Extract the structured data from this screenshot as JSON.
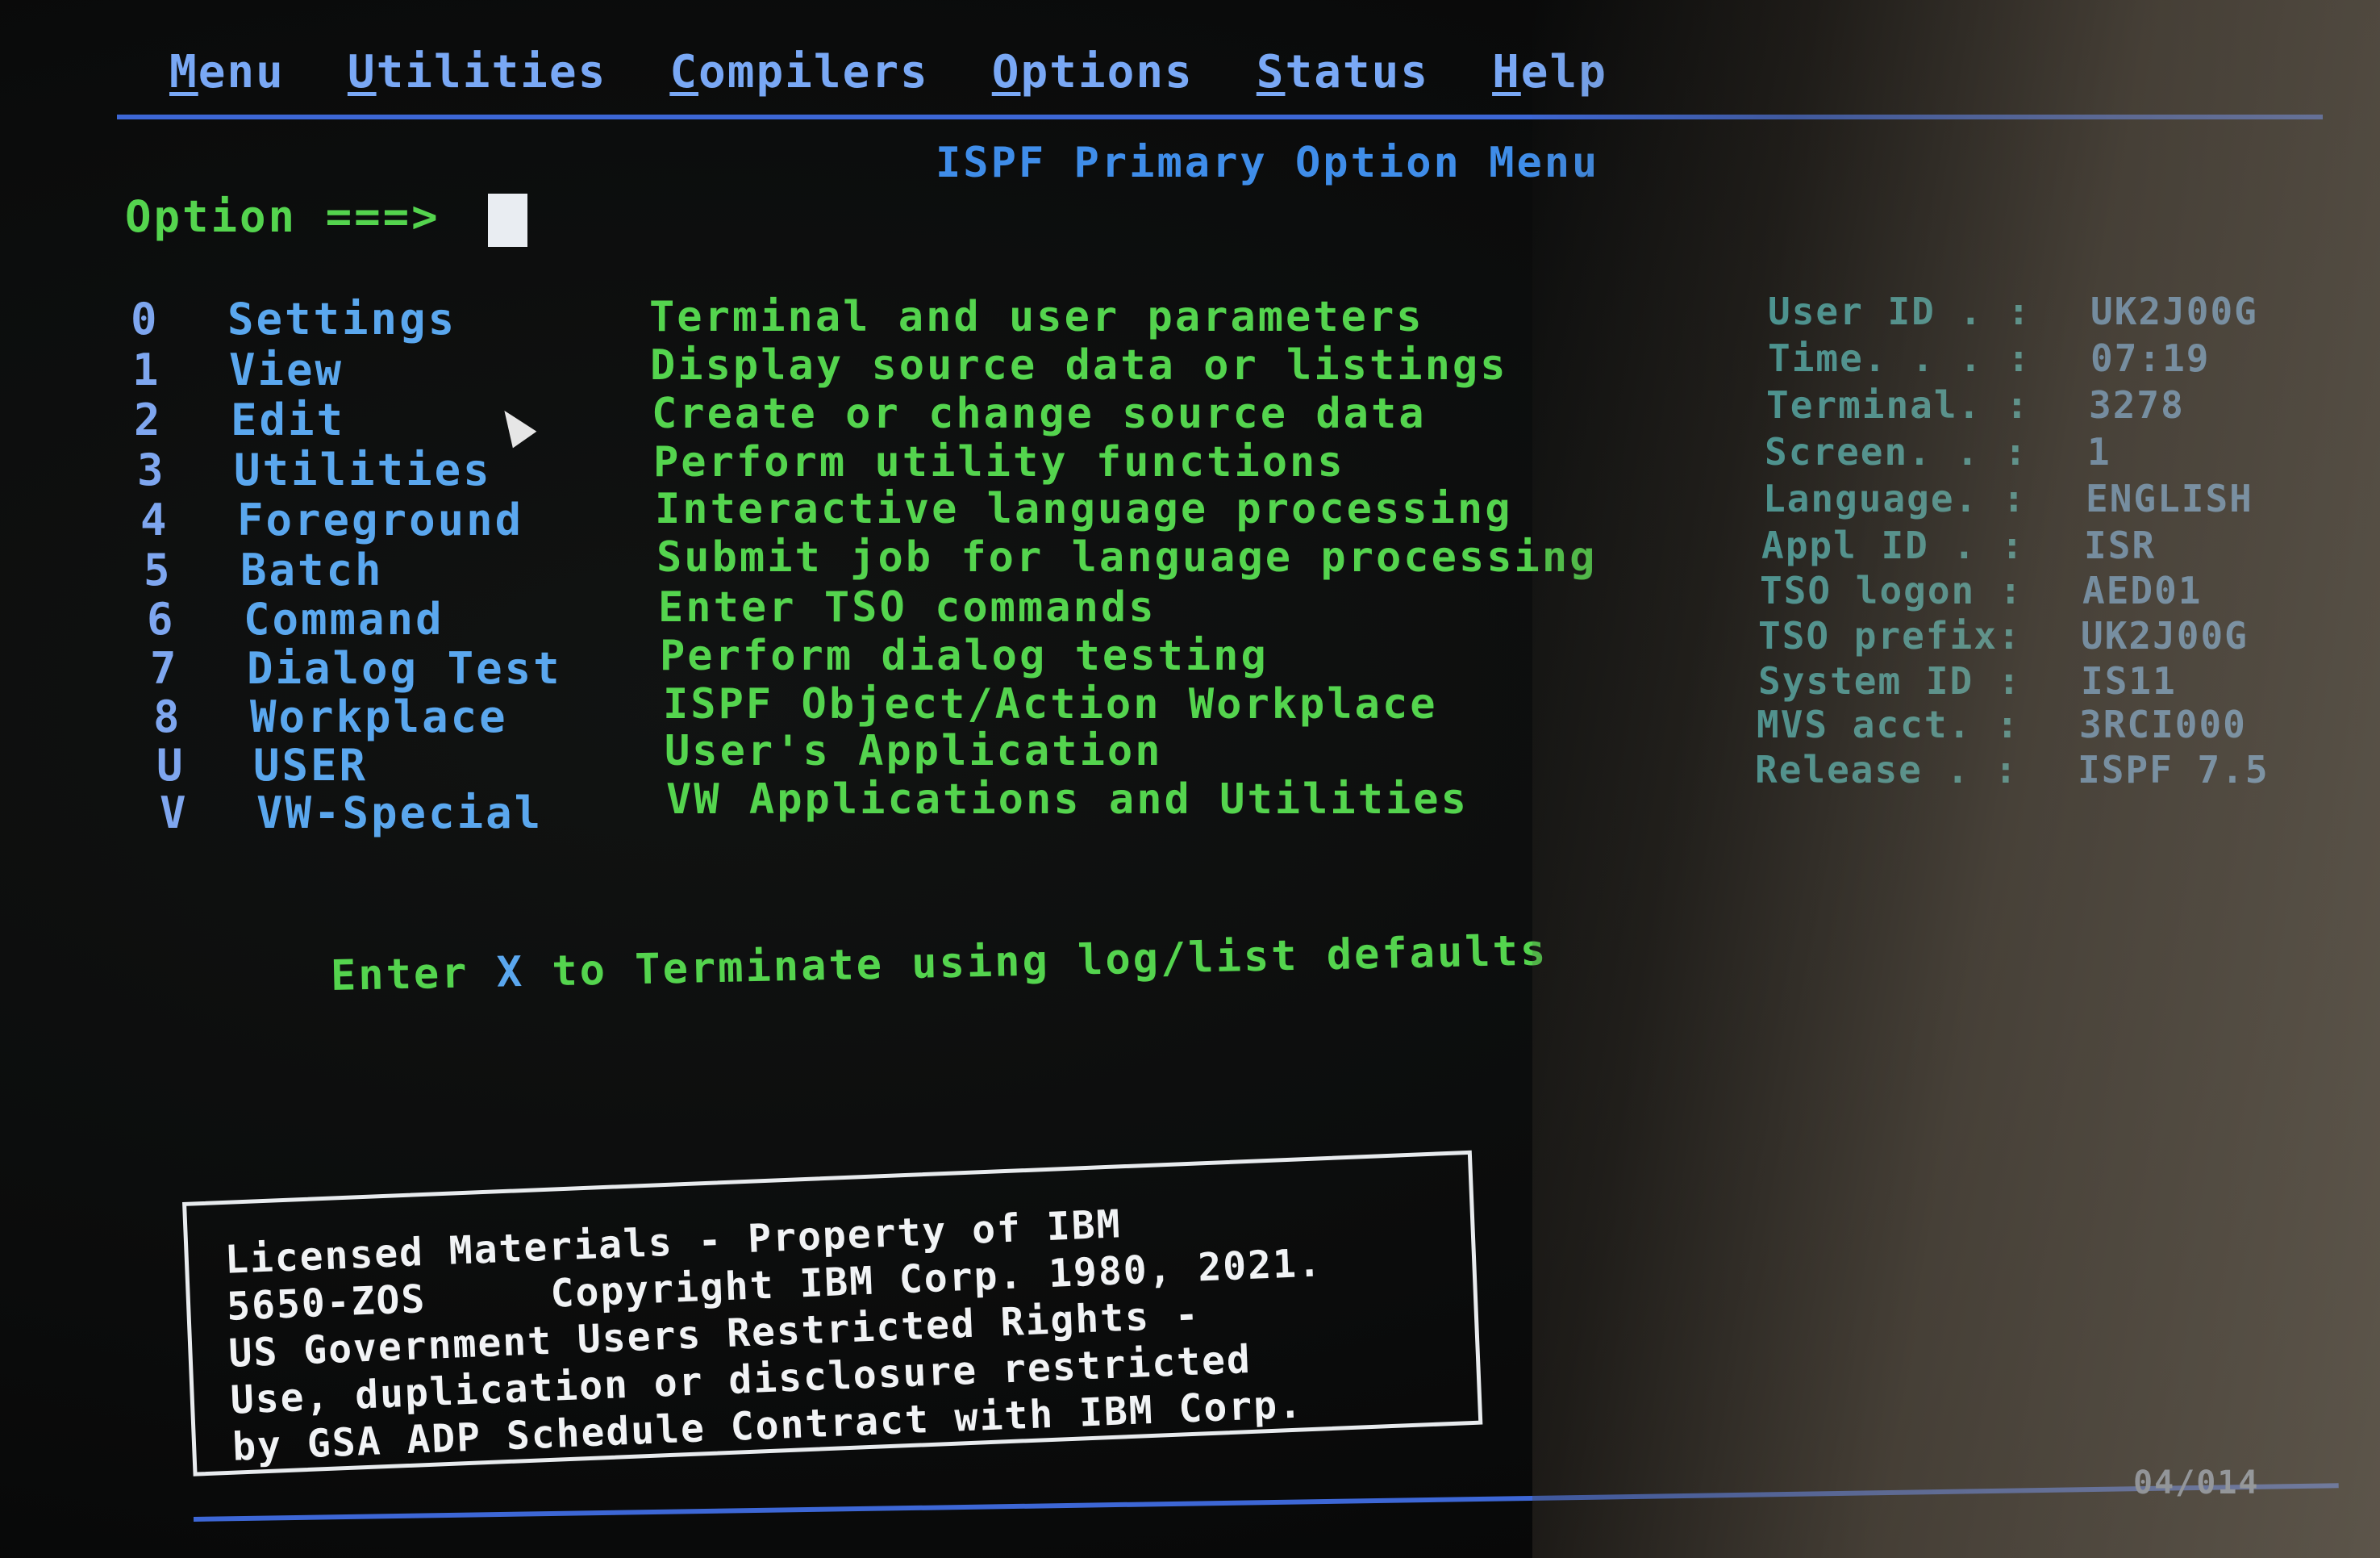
{
  "menubar": {
    "items": [
      {
        "mn": "M",
        "rest": "enu"
      },
      {
        "mn": "U",
        "rest": "tilities"
      },
      {
        "mn": "C",
        "rest": "ompilers"
      },
      {
        "mn": "O",
        "rest": "ptions"
      },
      {
        "mn": "S",
        "rest": "tatus"
      },
      {
        "mn": "H",
        "rest": "elp"
      }
    ]
  },
  "panel": {
    "title": "ISPF Primary Option Menu",
    "option_label": "Option ===>",
    "option_value": ""
  },
  "options": [
    {
      "key": "0",
      "name": "Settings",
      "desc": "Terminal and user parameters"
    },
    {
      "key": "1",
      "name": "View",
      "desc": "Display source data or listings"
    },
    {
      "key": "2",
      "name": "Edit",
      "desc": "Create or change source data"
    },
    {
      "key": "3",
      "name": "Utilities",
      "desc": "Perform utility functions"
    },
    {
      "key": "4",
      "name": "Foreground",
      "desc": "Interactive language processing"
    },
    {
      "key": "5",
      "name": "Batch",
      "desc": "Submit job for language processing"
    },
    {
      "key": "6",
      "name": "Command",
      "desc": "Enter TSO commands"
    },
    {
      "key": "7",
      "name": "Dialog Test",
      "desc": "Perform dialog testing"
    },
    {
      "key": "8",
      "name": "Workplace",
      "desc": "ISPF Object/Action Workplace"
    },
    {
      "key": "U",
      "name": "USER",
      "desc": "User's Application"
    },
    {
      "key": "V",
      "name": "VW-Special",
      "desc": "VW Applications and Utilities"
    }
  ],
  "info": [
    {
      "label": "User ID . :",
      "value": "UK2J00G"
    },
    {
      "label": "Time. . . :",
      "value": "07:19"
    },
    {
      "label": "Terminal. :",
      "value": "3278"
    },
    {
      "label": "Screen. . :",
      "value": "1"
    },
    {
      "label": "Language. :",
      "value": "ENGLISH"
    },
    {
      "label": "Appl ID . :",
      "value": "ISR"
    },
    {
      "label": "TSO logon :",
      "value": "AED01"
    },
    {
      "label": "TSO prefix:",
      "value": "UK2J00G"
    },
    {
      "label": "System ID :",
      "value": "IS11"
    },
    {
      "label": "MVS acct. :",
      "value": "3RCI000"
    },
    {
      "label": "Release . :",
      "value": "ISPF 7.5"
    }
  ],
  "terminate": {
    "before": "Enter ",
    "key": "X",
    "after": " to Terminate using log/list defaults"
  },
  "license": {
    "lines": [
      "Licensed Materials - Property of IBM",
      "5650-ZOS     Copyright IBM Corp. 1980, 2021.",
      "US Government Users Restricted Rights -",
      "Use, duplication or disclosure restricted",
      "by GSA ADP Schedule Contract with IBM Corp."
    ]
  },
  "status": {
    "screen_id": "04/014"
  },
  "colors": {
    "menu_text": "#79a8f5",
    "label_green": "#54d44e",
    "option_name_blue": "#5aa7ee",
    "info_label_cyan": "#4dc0c0",
    "rule_blue": "#3d67d6",
    "license_white": "#f1f3f5"
  },
  "icons": {
    "mouse_pointer": "pointer-icon"
  }
}
